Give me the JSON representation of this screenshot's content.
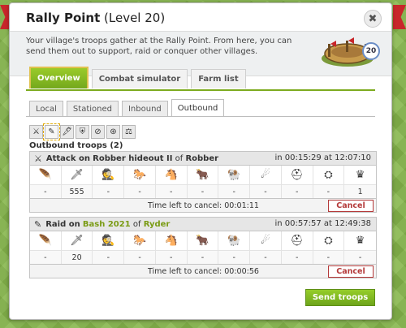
{
  "dialog": {
    "title": "Rally Point",
    "level_text": "(Level 20)",
    "close_glyph": "✖",
    "intro": "Your village's troops gather at the Rally Point. From here, you can send them out to support, raid or conquer other villages.",
    "building_level": "20"
  },
  "main_tabs": [
    {
      "label": "Overview",
      "active": true
    },
    {
      "label": "Combat simulator",
      "active": false
    },
    {
      "label": "Farm list",
      "active": false
    }
  ],
  "sub_tabs": [
    {
      "label": "Local",
      "active": false
    },
    {
      "label": "Stationed",
      "active": false
    },
    {
      "label": "Inbound",
      "active": false
    },
    {
      "label": "Outbound",
      "active": true
    }
  ],
  "filters": [
    {
      "icon": "attack-icon",
      "glyph": "⚔"
    },
    {
      "icon": "raid-icon",
      "glyph": "✎"
    },
    {
      "icon": "spy-icon",
      "glyph": "🖋"
    },
    {
      "icon": "support-icon",
      "glyph": "⛨"
    },
    {
      "icon": "no-support-icon",
      "glyph": "⊘"
    },
    {
      "icon": "settler-icon",
      "glyph": "⊛"
    },
    {
      "icon": "trade-icon",
      "glyph": "⚖"
    }
  ],
  "outbound_title": "Outbound troops (2)",
  "movements": [
    {
      "type_icon": "⚔",
      "action": "Attack on",
      "target": "Robber hideout II",
      "of_word": "of",
      "owner": "Robber",
      "time": "in 00:15:29 at 12:07:10",
      "counts": [
        "-",
        "555",
        "-",
        "-",
        "-",
        "-",
        "-",
        "-",
        "-",
        "-",
        "1"
      ],
      "cancel_label": "Time left to cancel:",
      "cancel_time": "00:01:11",
      "cancel_button": "Cancel"
    },
    {
      "type_icon": "✎",
      "action": "Raid on",
      "target": "Bash 2021",
      "of_word": "of",
      "owner": "Ryder",
      "time": "in 00:57:57 at 12:49:38",
      "counts": [
        "-",
        "20",
        "-",
        "-",
        "-",
        "-",
        "-",
        "-",
        "-",
        "-",
        "-"
      ],
      "cancel_label": "Time left to cancel:",
      "cancel_time": "00:00:56",
      "cancel_button": "Cancel"
    }
  ],
  "unit_icons": [
    {
      "name": "feather-unit-icon",
      "glyph": "🪶"
    },
    {
      "name": "sword-unit-icon",
      "glyph": "🗡"
    },
    {
      "name": "scout-unit-icon",
      "glyph": "🕵"
    },
    {
      "name": "horse-scout-unit-icon",
      "glyph": "🐎"
    },
    {
      "name": "light-cavalry-unit-icon",
      "glyph": "🐴"
    },
    {
      "name": "heavy-cavalry-unit-icon",
      "glyph": "🐂"
    },
    {
      "name": "ram-unit-icon",
      "glyph": "🐏"
    },
    {
      "name": "catapult-unit-icon",
      "glyph": "☄"
    },
    {
      "name": "chief-unit-icon",
      "glyph": "⛑"
    },
    {
      "name": "settler-unit-icon",
      "glyph": "⛭"
    },
    {
      "name": "hero-unit-icon",
      "glyph": "♛"
    }
  ],
  "send_button": "Send troops",
  "colors": {
    "accent": "#7dab1f",
    "cancel": "#b43a3a",
    "link": "#7a9b14"
  }
}
